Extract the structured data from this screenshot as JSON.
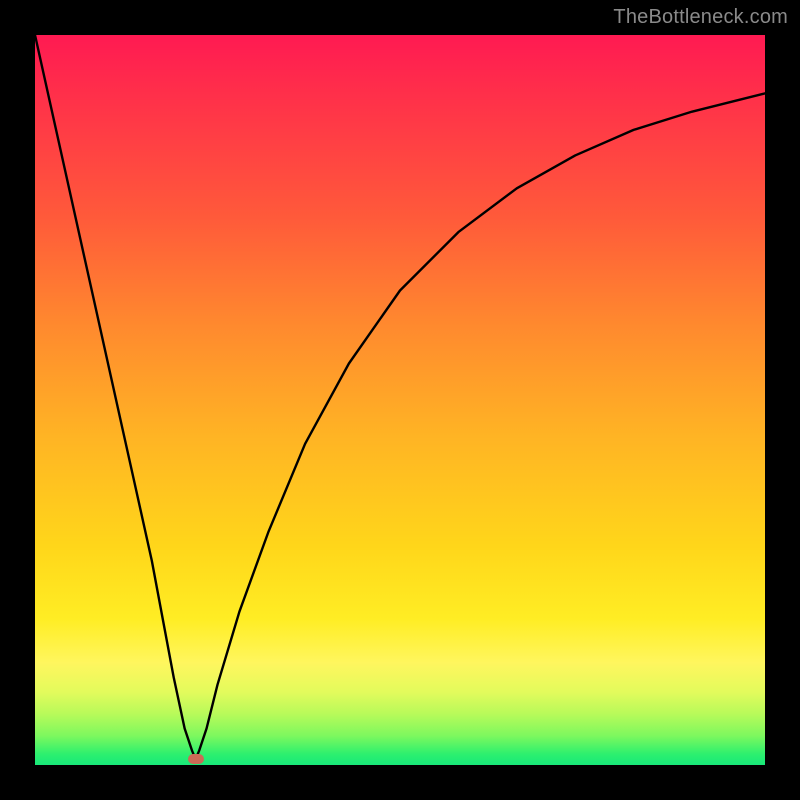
{
  "watermark": "TheBottleneck.com",
  "chart_data": {
    "type": "line",
    "title": "",
    "xlabel": "",
    "ylabel": "",
    "xlim": [
      0,
      100
    ],
    "ylim": [
      0,
      100
    ],
    "grid": false,
    "legend": false,
    "min_point": {
      "x": 22,
      "y": 0.8
    },
    "series": [
      {
        "name": "bottleneck-curve",
        "x": [
          0,
          4,
          8,
          12,
          16,
          19,
          20.5,
          21.5,
          22,
          22.5,
          23.5,
          25,
          28,
          32,
          37,
          43,
          50,
          58,
          66,
          74,
          82,
          90,
          96,
          100
        ],
        "y": [
          100,
          82,
          64,
          46,
          28,
          12,
          5,
          2,
          0.8,
          2,
          5,
          11,
          21,
          32,
          44,
          55,
          65,
          73,
          79,
          83.5,
          87,
          89.5,
          91,
          92
        ]
      }
    ],
    "background_gradient": {
      "stops": [
        {
          "pos": 0,
          "color": "#ff1a52"
        },
        {
          "pos": 0.25,
          "color": "#ff5a3a"
        },
        {
          "pos": 0.55,
          "color": "#ffb424"
        },
        {
          "pos": 0.8,
          "color": "#ffed24"
        },
        {
          "pos": 0.93,
          "color": "#b8fa5a"
        },
        {
          "pos": 1.0,
          "color": "#18e879"
        }
      ]
    },
    "annotation_color": "#cb6a56"
  }
}
